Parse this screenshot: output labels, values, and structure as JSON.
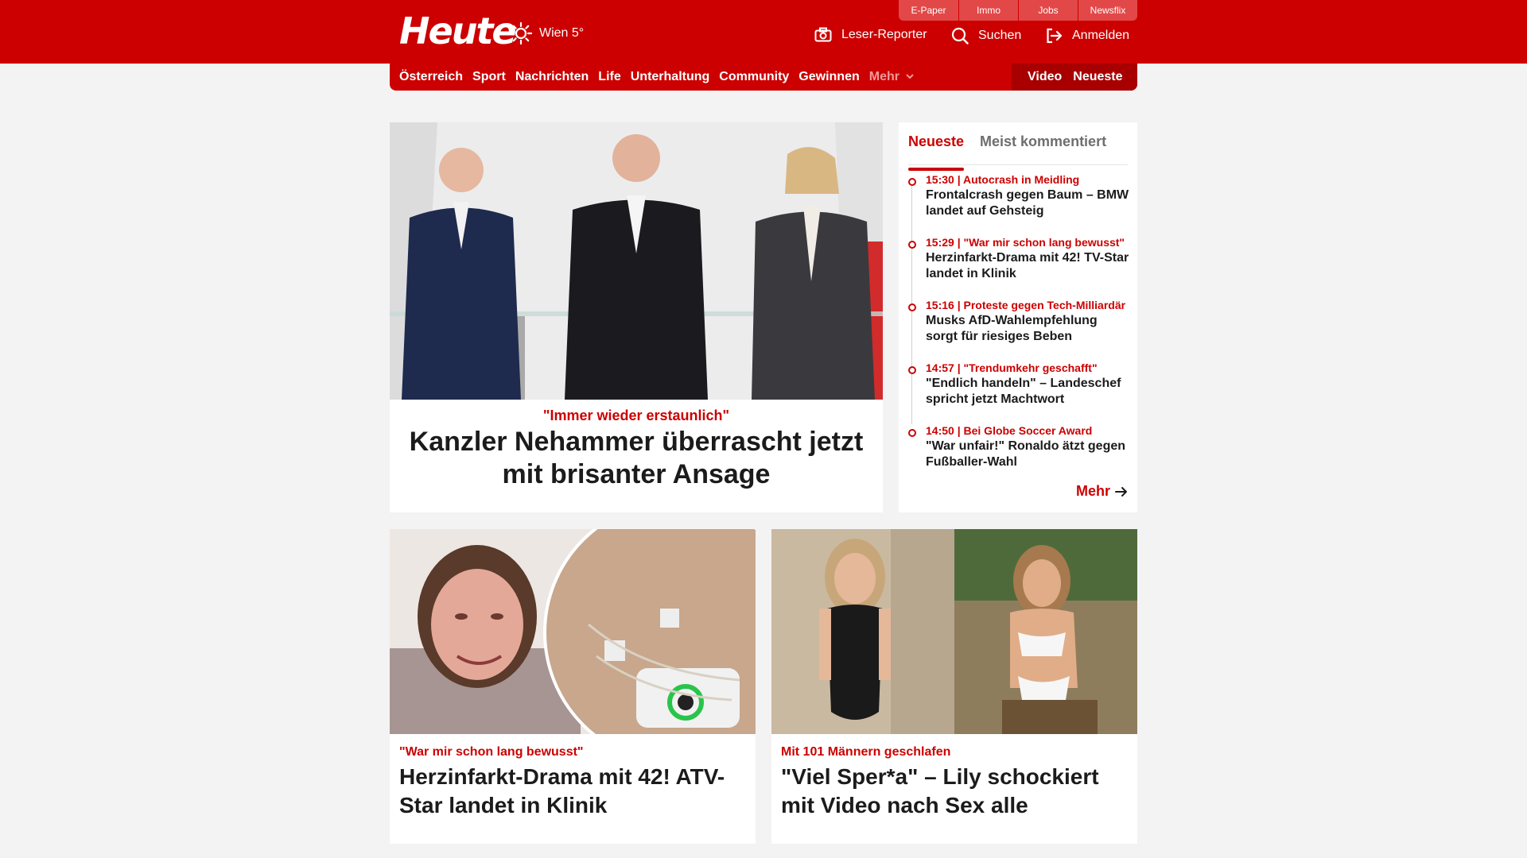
{
  "brand": {
    "logo_text": "Heute",
    "weather": "Wien 5°",
    "accent": "#cc0000"
  },
  "top_links": [
    "E-Paper",
    "Immo",
    "Jobs",
    "Newsflix"
  ],
  "header_actions": {
    "reporter": "Leser-Reporter",
    "search": "Suchen",
    "login": "Anmelden"
  },
  "nav": {
    "items": [
      "Österreich",
      "Sport",
      "Nachrichten",
      "Life",
      "Unterhaltung",
      "Community",
      "Gewinnen"
    ],
    "more": "Mehr",
    "video": "Video",
    "latest": "Neueste"
  },
  "hero": {
    "kicker": "\"Immer wieder erstaunlich\"",
    "title": "Kanzler Nehammer überrascht jetzt mit brisanter Ansage"
  },
  "sidebar": {
    "tabs": [
      "Neueste",
      "Meist kommentiert"
    ],
    "items": [
      {
        "meta": "15:30 | Autocrash in Meidling",
        "title": "Frontalcrash gegen Baum – BMW landet auf Gehsteig"
      },
      {
        "meta": "15:29 | \"War mir schon lang bewusst\"",
        "title": "Herzinfarkt-Drama mit 42! TV-Star landet in Klinik"
      },
      {
        "meta": "15:16 | Proteste gegen Tech-Milliardär",
        "title": "Musks AfD-Wahlempfehlung sorgt für riesiges Beben"
      },
      {
        "meta": "14:57 | \"Trendumkehr geschafft\"",
        "title": "\"Endlich handeln\" – Landeschef spricht jetzt Machtwort"
      },
      {
        "meta": "14:50 | Bei Globe Soccer Award",
        "title": "\"War unfair!\" Ronaldo ätzt gegen Fußballer-Wahl"
      }
    ],
    "more": "Mehr"
  },
  "cards": [
    {
      "kicker": "\"War mir schon lang bewusst\"",
      "title": "Herzinfarkt-Drama mit 42! ATV-Star landet in Klinik"
    },
    {
      "kicker": "Mit 101 Männern geschlafen",
      "title": "\"Viel Sper*a\" – Lily schockiert mit Video nach Sex alle"
    }
  ]
}
